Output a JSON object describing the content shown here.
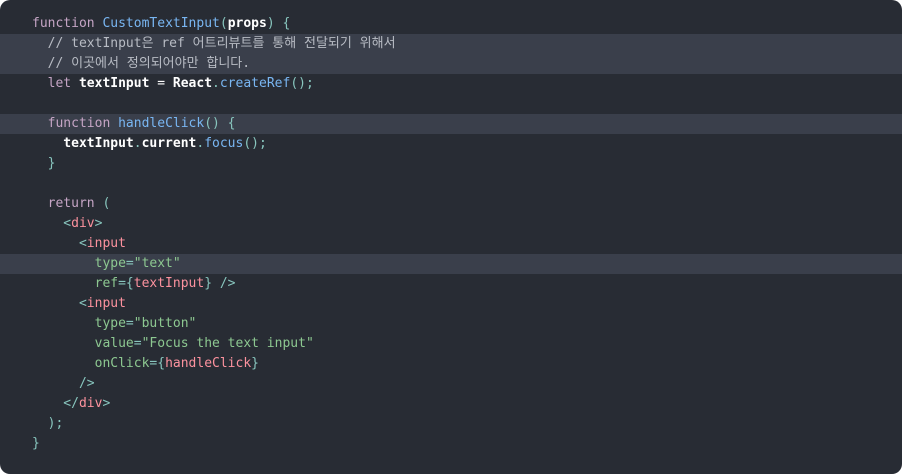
{
  "code": {
    "lines": [
      {
        "tokens": [
          {
            "t": "function",
            "c": "kw"
          },
          {
            "t": " ",
            "c": "var"
          },
          {
            "t": "CustomTextInput",
            "c": "fn"
          },
          {
            "t": "(",
            "c": "punc"
          },
          {
            "t": "props",
            "c": "prm"
          },
          {
            "t": ")",
            "c": "punc"
          },
          {
            "t": " {",
            "c": "punc"
          }
        ],
        "highlighted": false
      },
      {
        "tokens": [
          {
            "t": "  // textInput은 ref 어트리뷰트를 통해 전달되기 위해서",
            "c": "cm"
          }
        ],
        "highlighted": true
      },
      {
        "tokens": [
          {
            "t": "  // 이곳에서 정의되어야만 합니다.",
            "c": "cm"
          }
        ],
        "highlighted": true
      },
      {
        "tokens": [
          {
            "t": "  let",
            "c": "kw"
          },
          {
            "t": " textInput ",
            "c": "prm"
          },
          {
            "t": "= ",
            "c": "var"
          },
          {
            "t": "React",
            "c": "prm"
          },
          {
            "t": ".",
            "c": "punc"
          },
          {
            "t": "createRef",
            "c": "mth"
          },
          {
            "t": "();",
            "c": "punc"
          }
        ],
        "highlighted": false
      },
      {
        "tokens": [
          {
            "t": "",
            "c": "var"
          }
        ],
        "highlighted": false
      },
      {
        "tokens": [
          {
            "t": "  function",
            "c": "kw"
          },
          {
            "t": " ",
            "c": "var"
          },
          {
            "t": "handleClick",
            "c": "fn"
          },
          {
            "t": "() {",
            "c": "punc"
          }
        ],
        "highlighted": true
      },
      {
        "tokens": [
          {
            "t": "    textInput",
            "c": "prm"
          },
          {
            "t": ".",
            "c": "punc"
          },
          {
            "t": "current",
            "c": "prm"
          },
          {
            "t": ".",
            "c": "punc"
          },
          {
            "t": "focus",
            "c": "mth"
          },
          {
            "t": "();",
            "c": "punc"
          }
        ],
        "highlighted": false
      },
      {
        "tokens": [
          {
            "t": "  }",
            "c": "punc"
          }
        ],
        "highlighted": false
      },
      {
        "tokens": [
          {
            "t": "",
            "c": "var"
          }
        ],
        "highlighted": false
      },
      {
        "tokens": [
          {
            "t": "  return",
            "c": "kw"
          },
          {
            "t": " (",
            "c": "punc"
          }
        ],
        "highlighted": false
      },
      {
        "tokens": [
          {
            "t": "    <",
            "c": "punc"
          },
          {
            "t": "div",
            "c": "tag"
          },
          {
            "t": ">",
            "c": "punc"
          }
        ],
        "highlighted": false
      },
      {
        "tokens": [
          {
            "t": "      <",
            "c": "punc"
          },
          {
            "t": "input",
            "c": "tag"
          }
        ],
        "highlighted": false
      },
      {
        "tokens": [
          {
            "t": "        type",
            "c": "attr"
          },
          {
            "t": "=",
            "c": "punc"
          },
          {
            "t": "\"text\"",
            "c": "str"
          }
        ],
        "highlighted": true
      },
      {
        "tokens": [
          {
            "t": "        ref",
            "c": "attr"
          },
          {
            "t": "={",
            "c": "punc"
          },
          {
            "t": "textInput",
            "c": "expr"
          },
          {
            "t": "} />",
            "c": "punc"
          }
        ],
        "highlighted": false
      },
      {
        "tokens": [
          {
            "t": "      <",
            "c": "punc"
          },
          {
            "t": "input",
            "c": "tag"
          }
        ],
        "highlighted": false
      },
      {
        "tokens": [
          {
            "t": "        type",
            "c": "attr"
          },
          {
            "t": "=",
            "c": "punc"
          },
          {
            "t": "\"button\"",
            "c": "str"
          }
        ],
        "highlighted": false
      },
      {
        "tokens": [
          {
            "t": "        value",
            "c": "attr"
          },
          {
            "t": "=",
            "c": "punc"
          },
          {
            "t": "\"Focus the text input\"",
            "c": "str"
          }
        ],
        "highlighted": false
      },
      {
        "tokens": [
          {
            "t": "        onClick",
            "c": "attr"
          },
          {
            "t": "={",
            "c": "punc"
          },
          {
            "t": "handleClick",
            "c": "expr"
          },
          {
            "t": "}",
            "c": "punc"
          }
        ],
        "highlighted": false
      },
      {
        "tokens": [
          {
            "t": "      />",
            "c": "punc"
          }
        ],
        "highlighted": false
      },
      {
        "tokens": [
          {
            "t": "    </",
            "c": "punc"
          },
          {
            "t": "div",
            "c": "tag"
          },
          {
            "t": ">",
            "c": "punc"
          }
        ],
        "highlighted": false
      },
      {
        "tokens": [
          {
            "t": "  );",
            "c": "punc"
          }
        ],
        "highlighted": false
      },
      {
        "tokens": [
          {
            "t": "}",
            "c": "punc"
          }
        ],
        "highlighted": false
      }
    ]
  },
  "colors": {
    "background": "#282c34",
    "highlight": "#3a3f4b",
    "keyword": "#c5a5c5",
    "function": "#79b6f2",
    "string": "#8dc891",
    "tag": "#fc929e",
    "comment": "#b8bcc4"
  }
}
